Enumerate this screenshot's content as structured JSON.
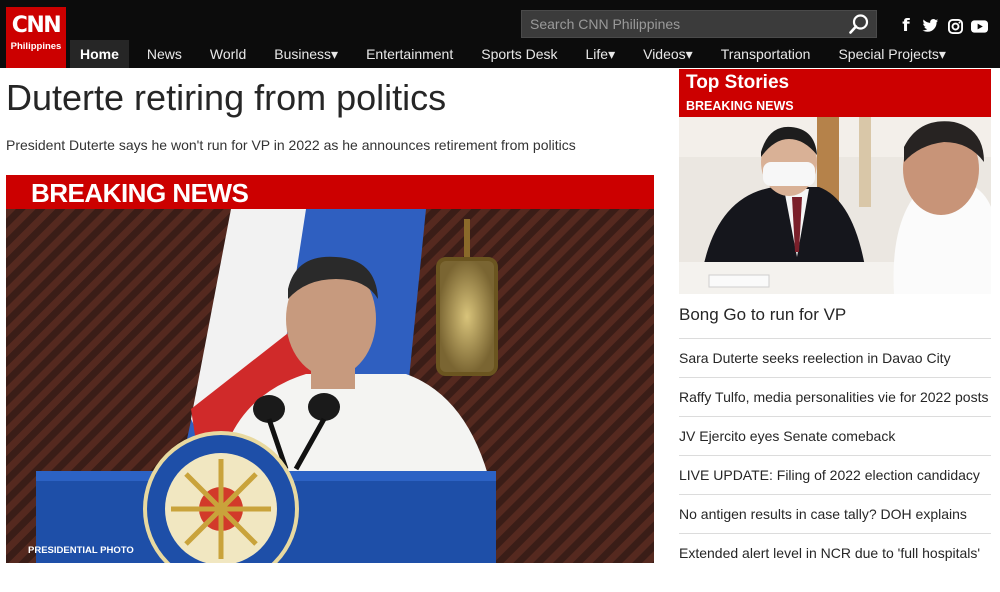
{
  "brand": {
    "logo_text": "CNN",
    "logo_sub": "Philippines",
    "accent": "#cc0000"
  },
  "search": {
    "placeholder": "Search CNN Philippines"
  },
  "social": [
    "facebook-icon",
    "twitter-icon",
    "instagram-icon",
    "youtube-icon"
  ],
  "nav": {
    "home": "Home",
    "news": "News",
    "world": "World",
    "business": "Business▾",
    "entertainment": "Entertainment",
    "sports": "Sports Desk",
    "life": "Life▾",
    "videos": "Videos▾",
    "transportation": "Transportation",
    "special": "Special Projects▾"
  },
  "main": {
    "headline": "Duterte retiring from politics",
    "subhead": "President Duterte says he won't run for VP in 2022 as he announces retirement from politics",
    "breaking_label": "BREAKING NEWS",
    "photo_credit": "PRESIDENTIAL PHOTO"
  },
  "sidebar": {
    "title": "Top Stories",
    "subtitle": "BREAKING NEWS",
    "lead": "Bong Go to run for VP",
    "stories": [
      "Sara Duterte seeks reelection in Davao City",
      "Raffy Tulfo, media personalities vie for 2022 posts",
      "JV Ejercito eyes Senate comeback",
      "LIVE UPDATE: Filing of 2022 election candidacy",
      "No antigen results in case tally? DOH explains",
      "Extended alert level in NCR due to 'full hospitals'"
    ]
  }
}
